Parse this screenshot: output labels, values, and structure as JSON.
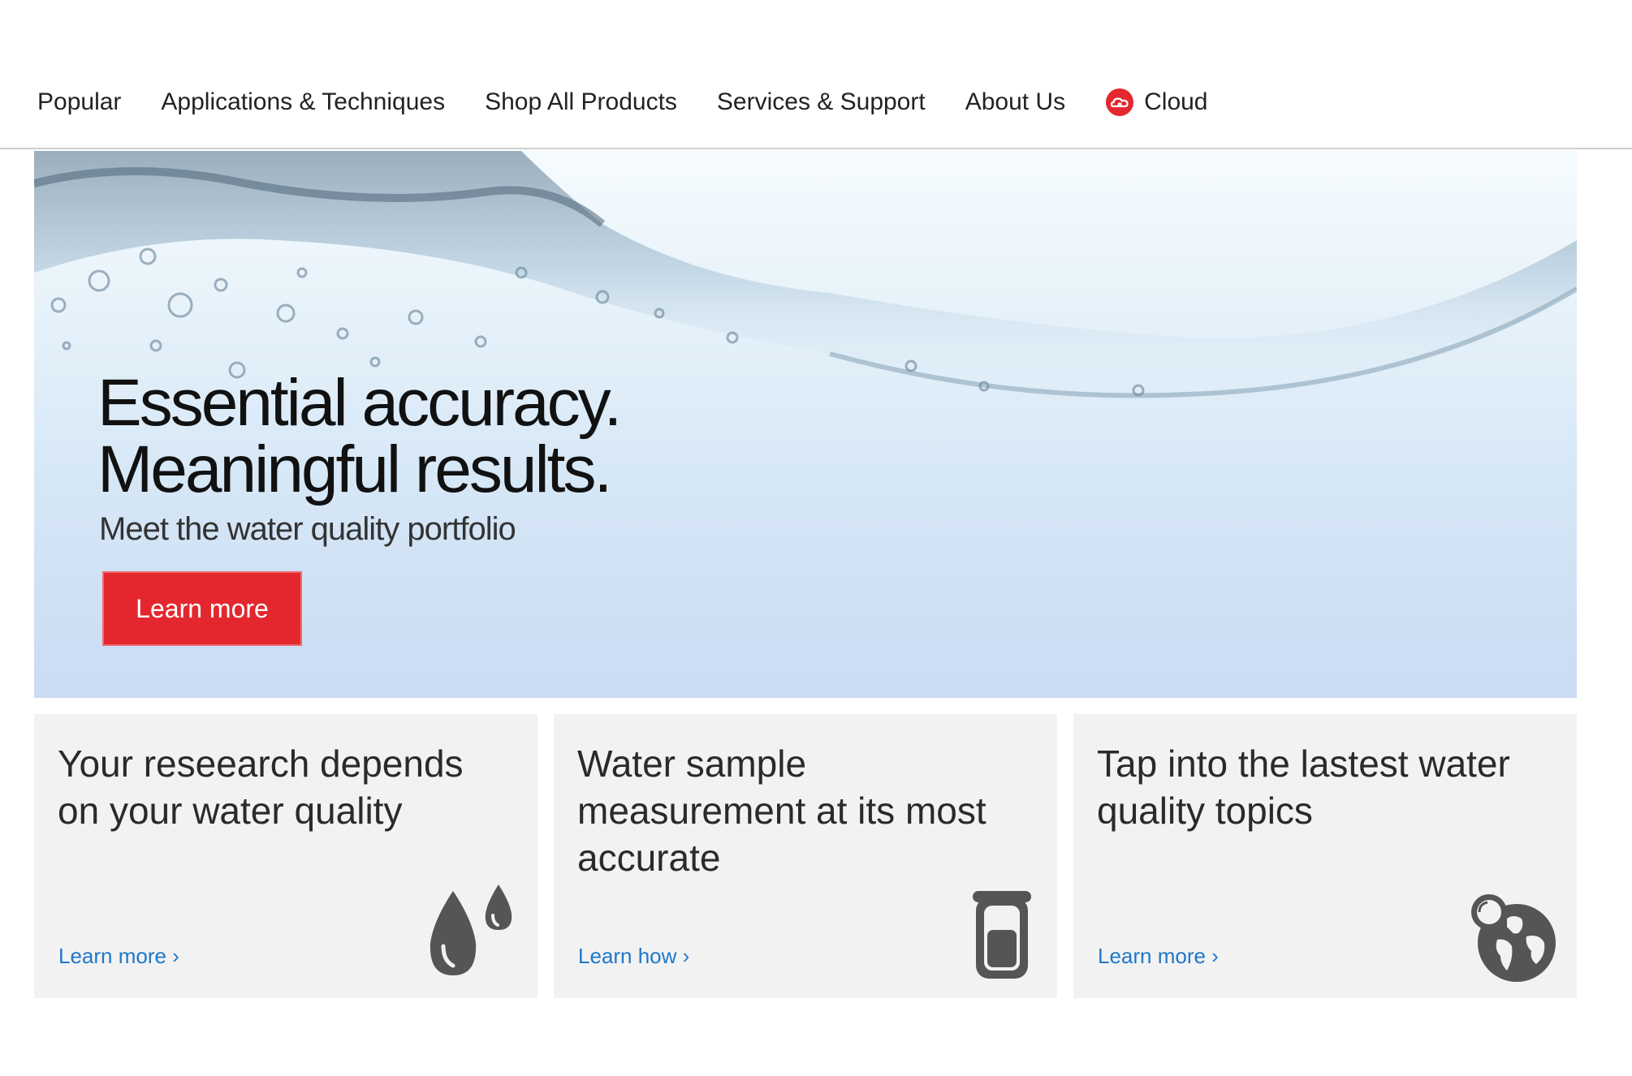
{
  "nav": {
    "items": [
      {
        "label": "Popular"
      },
      {
        "label": "Applications & Techniques"
      },
      {
        "label": "Shop All Products"
      },
      {
        "label": "Services & Support"
      },
      {
        "label": "About Us"
      },
      {
        "label": "Cloud",
        "icon": "cloud-icon"
      }
    ]
  },
  "hero": {
    "headline_line1": "Essential accuracy.",
    "headline_line2": "Meaningful results.",
    "subtitle": "Meet the water quality portfolio",
    "button_label": "Learn more"
  },
  "cards": [
    {
      "title": "Your reseearch depends on your water quality",
      "link": "Learn more ›",
      "icon": "water-drops-icon"
    },
    {
      "title": "Water sample measurement at its most accurate",
      "link": "Learn how ›",
      "icon": "sample-tube-icon"
    },
    {
      "title": "Tap into the lastest water quality topics",
      "link": "Learn more ›",
      "icon": "globe-search-icon"
    }
  ],
  "colors": {
    "accent_red": "#e4272e",
    "link_blue": "#1f77c9",
    "card_bg": "#f2f2f2",
    "icon_gray": "#555555"
  }
}
